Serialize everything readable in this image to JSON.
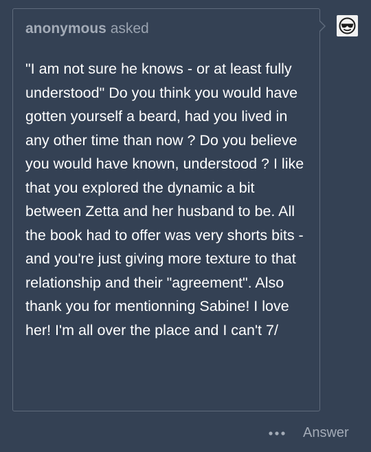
{
  "ask": {
    "asker_name": "anonymous",
    "asked_label": "asked",
    "question": "\"I am not sure he knows - or at least fully understood\" Do you think you would have gotten yourself a beard, had you lived in any other time than now ? Do you believe you would have known, understood ? I like that you explored the dynamic a bit between Zetta and her husband to be. All the book had to offer was very shorts bits - and you're just giving more texture to that relationship and their \"agreement\". Also thank you for mentionning Sabine! I love her! I'm all over the place and I can't 7/"
  },
  "avatar": {
    "icon": "anonymous-avatar-icon"
  },
  "footer": {
    "more_icon": "ellipsis-icon",
    "answer_label": "Answer"
  },
  "colors": {
    "background": "#344154",
    "card_border": "#5f6b7c",
    "question_text": "#ffffff",
    "muted_text": "#a3abb7"
  }
}
